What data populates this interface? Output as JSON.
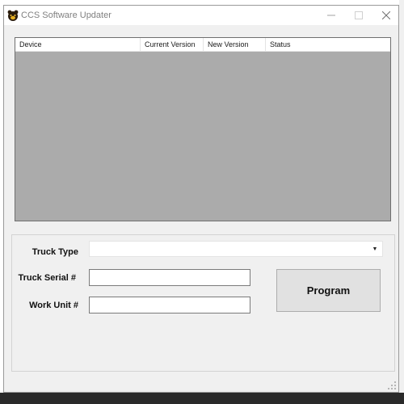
{
  "window": {
    "title": "CCS Software Updater",
    "icon": "bear-app-icon",
    "controls": {
      "minimize_icon": "minimize-icon",
      "maximize_icon": "maximize-icon",
      "close_icon": "close-icon"
    }
  },
  "device_list": {
    "columns": [
      "Device",
      "Current Version",
      "New Version",
      "Status"
    ],
    "rows": []
  },
  "form": {
    "truck_type_label": "Truck Type",
    "truck_type_value": "",
    "truck_serial_label": "Truck Serial #",
    "truck_serial_value": "",
    "work_unit_label": "Work Unit #",
    "work_unit_value": "",
    "program_button_label": "Program"
  },
  "colors": {
    "window_bg": "#f0f0f0",
    "list_bg": "#ababab",
    "button_bg": "#e1e1e1",
    "title_text": "#808080"
  }
}
